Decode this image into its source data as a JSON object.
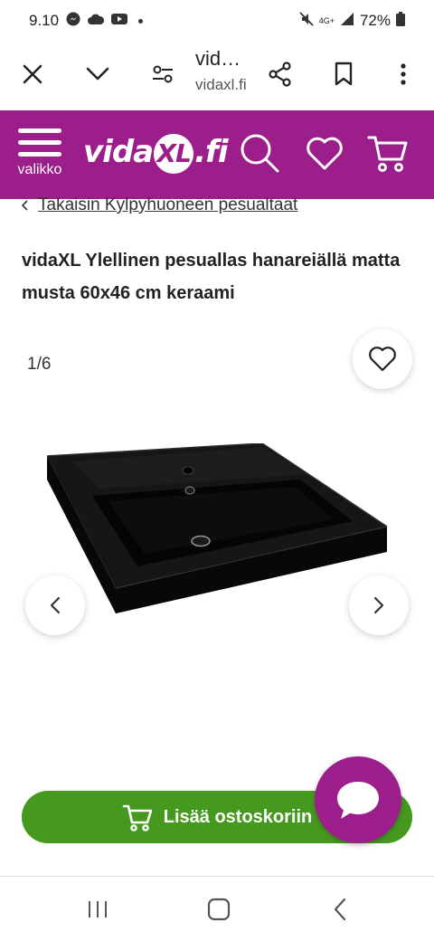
{
  "status_bar": {
    "time": "9.10",
    "network": "4G+",
    "battery": "72%",
    "icons": [
      "messenger-icon",
      "cloud-icon",
      "youtube-icon",
      "dot-icon",
      "mute-icon",
      "signal-icon",
      "battery-icon"
    ]
  },
  "browser": {
    "page_title": "vid…",
    "domain": "vidaxl.fi",
    "icons": [
      "close-icon",
      "chevron-down-icon",
      "page-settings-icon",
      "share-icon",
      "bookmark-icon",
      "more-icon"
    ]
  },
  "site_header": {
    "menu_label": "valikko",
    "logo_left": "vida",
    "logo_xl": "XL",
    "logo_right": ".fi",
    "brand_color": "#9c1e8a",
    "icons": [
      "menu-icon",
      "search-icon",
      "heart-icon",
      "cart-icon"
    ]
  },
  "breadcrumb": {
    "text": "Takaisin Kylpyhuoneen pesualtaat"
  },
  "product": {
    "title": "vidaXL Ylellinen pesuallas hanareiällä matta musta 60x46 cm keraami"
  },
  "gallery": {
    "counter": "1/6",
    "icons": [
      "wishlist-heart-icon",
      "chevron-left-icon",
      "chevron-right-icon"
    ]
  },
  "cart": {
    "button_label": "Lisää ostoskoriin",
    "button_color": "#46991f"
  },
  "nav_bar": {
    "icons": [
      "recent-apps-icon",
      "home-icon",
      "back-icon"
    ]
  }
}
